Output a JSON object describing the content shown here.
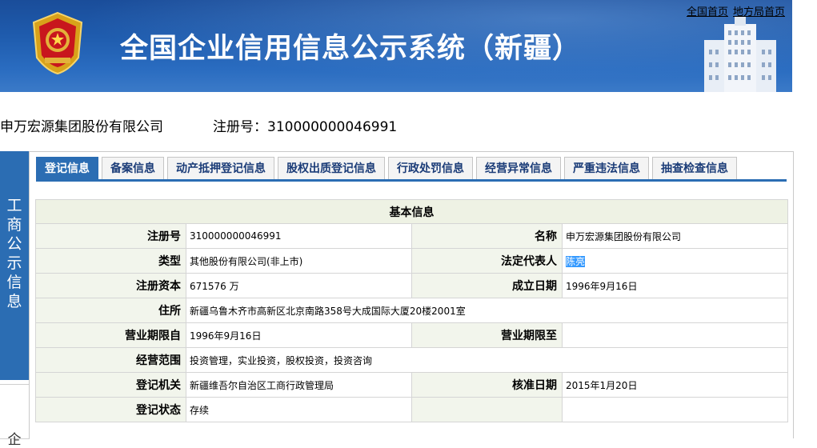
{
  "header": {
    "title": "全国企业信用信息公示系统（新疆）",
    "links": [
      "全国首页",
      "地方局首页"
    ]
  },
  "company": {
    "name": "申万宏源集团股份有限公司",
    "reg_label": "注册号：310000000046991"
  },
  "side": {
    "active_label": "工商公示信息",
    "next_label": "企"
  },
  "tabs": [
    "登记信息",
    "备案信息",
    "动产抵押登记信息",
    "股权出质登记信息",
    "行政处罚信息",
    "经营异常信息",
    "严重违法信息",
    "抽查检查信息"
  ],
  "basic_info": {
    "caption": "基本信息",
    "rows": [
      {
        "l1": "注册号",
        "v1": "310000000046991",
        "l2": "名称",
        "v2": "申万宏源集团股份有限公司"
      },
      {
        "l1": "类型",
        "v1": "其他股份有限公司(非上市)",
        "l2": "法定代表人",
        "v2": "陈亮"
      },
      {
        "l1": "注册资本",
        "v1": "671576 万",
        "l2": "成立日期",
        "v2": "1996年9月16日"
      },
      {
        "l1": "住所",
        "v1": "新疆乌鲁木齐市高新区北京南路358号大成国际大厦20楼2001室"
      },
      {
        "l1": "营业期限自",
        "v1": "1996年9月16日",
        "l2": "营业期限至",
        "v2": ""
      },
      {
        "l1": "经营范围",
        "v1": "投资管理，实业投资，股权投资，投资咨询"
      },
      {
        "l1": "登记机关",
        "v1": "新疆维吾尔自治区工商行政管理局",
        "l2": "核准日期",
        "v2": "2015年1月20日"
      },
      {
        "l1": "登记状态",
        "v1": "存续",
        "l2": "",
        "v2": ""
      }
    ]
  },
  "colors": {
    "accent": "#2b6db3",
    "banner": "#1f5cae",
    "label_bg": "#f2f5ec"
  },
  "icons": [
    "national-emblem-icon",
    "building-icon"
  ]
}
